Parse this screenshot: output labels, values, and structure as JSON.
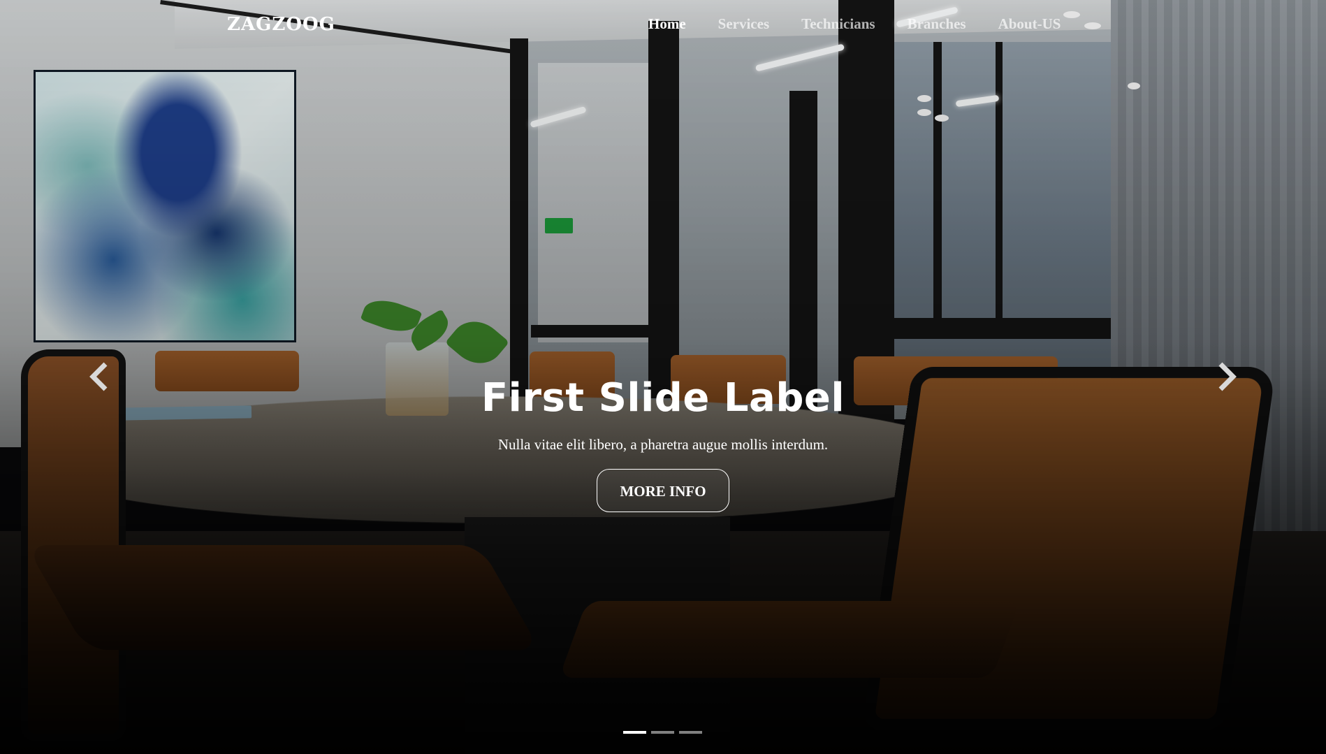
{
  "brand": "ZAGZOOG",
  "nav": {
    "items": [
      {
        "label": "Home",
        "active": true
      },
      {
        "label": "Services",
        "active": false
      },
      {
        "label": "Technicians",
        "active": false
      },
      {
        "label": "Branches",
        "active": false
      },
      {
        "label": "About-US",
        "active": false
      }
    ]
  },
  "carousel": {
    "active_slide": 1,
    "slide_count": 3,
    "slide": {
      "title": "First Slide Label",
      "text": "Nulla vitae elit libero, a pharetra augue mollis interdum.",
      "button_label": "MORE INFO"
    },
    "prev_icon": "chevron-left-icon",
    "next_icon": "chevron-right-icon"
  },
  "colors": {
    "text": "#ffffff",
    "nav_inactive": "rgba(255,255,255,0.68)",
    "overlay": "#000000"
  }
}
